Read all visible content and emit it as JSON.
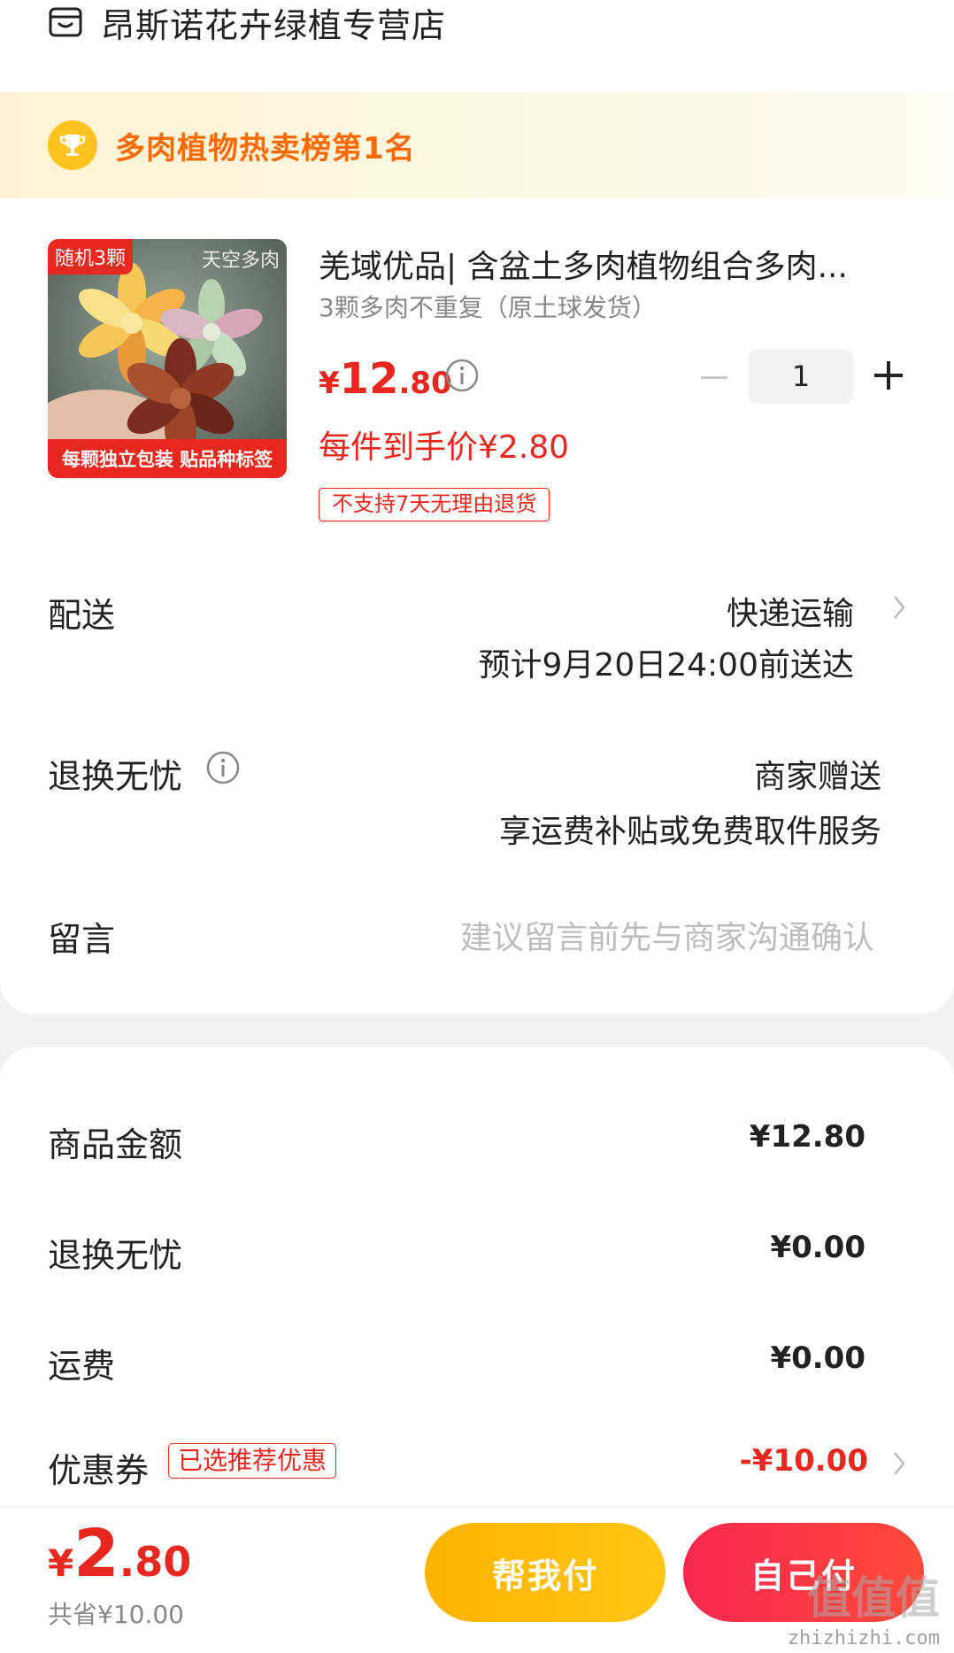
{
  "store": {
    "name": "昂斯诺花卉绿植专营店",
    "icon": "store-icon"
  },
  "rank": {
    "text": "多肉植物热卖榜第1名",
    "icon": "trophy-icon"
  },
  "product": {
    "thumbnail": {
      "tag": "随机3颗",
      "watermark": "天空多肉",
      "bottom_text": "每颗独立包装 贴品种标签"
    },
    "title": "羌域优品| 含盆土多肉植物组合多肉...",
    "sku": "3颗多肉不重复（原土球发货）",
    "price": {
      "symbol": "¥",
      "integer": "12",
      "decimal": ".80"
    },
    "unit_price": "每件到手价¥2.80",
    "badge": "不支持7天无理由退货",
    "quantity": "1"
  },
  "delivery": {
    "label": "配送",
    "method": "快递运输",
    "eta": "预计9月20日24:00前送达"
  },
  "returns": {
    "label": "退换无忧",
    "value": "商家赠送",
    "desc": "享运费补贴或免费取件服务"
  },
  "message": {
    "label": "留言",
    "placeholder": "建议留言前先与商家沟通确认"
  },
  "summary": {
    "goods_label": "商品金额",
    "goods_value": "¥12.80",
    "returns_label": "退换无忧",
    "returns_value": "¥0.00",
    "shipping_label": "运费",
    "shipping_value": "¥0.00",
    "coupon_label": "优惠券",
    "coupon_tag": "已选推荐优惠",
    "coupon_value": "-¥10.00"
  },
  "bottom": {
    "total": {
      "symbol": "¥",
      "integer": "2",
      "decimal": ".80"
    },
    "saved": "共省¥10.00",
    "help_pay": "帮我付",
    "self_pay": "自己付"
  },
  "watermark": {
    "logo": "值值值",
    "site": "zhizhizhi.com"
  },
  "colors": {
    "accent_red": "#e8271f",
    "orange": "#ff6a00",
    "gold": "#ffc31f"
  }
}
